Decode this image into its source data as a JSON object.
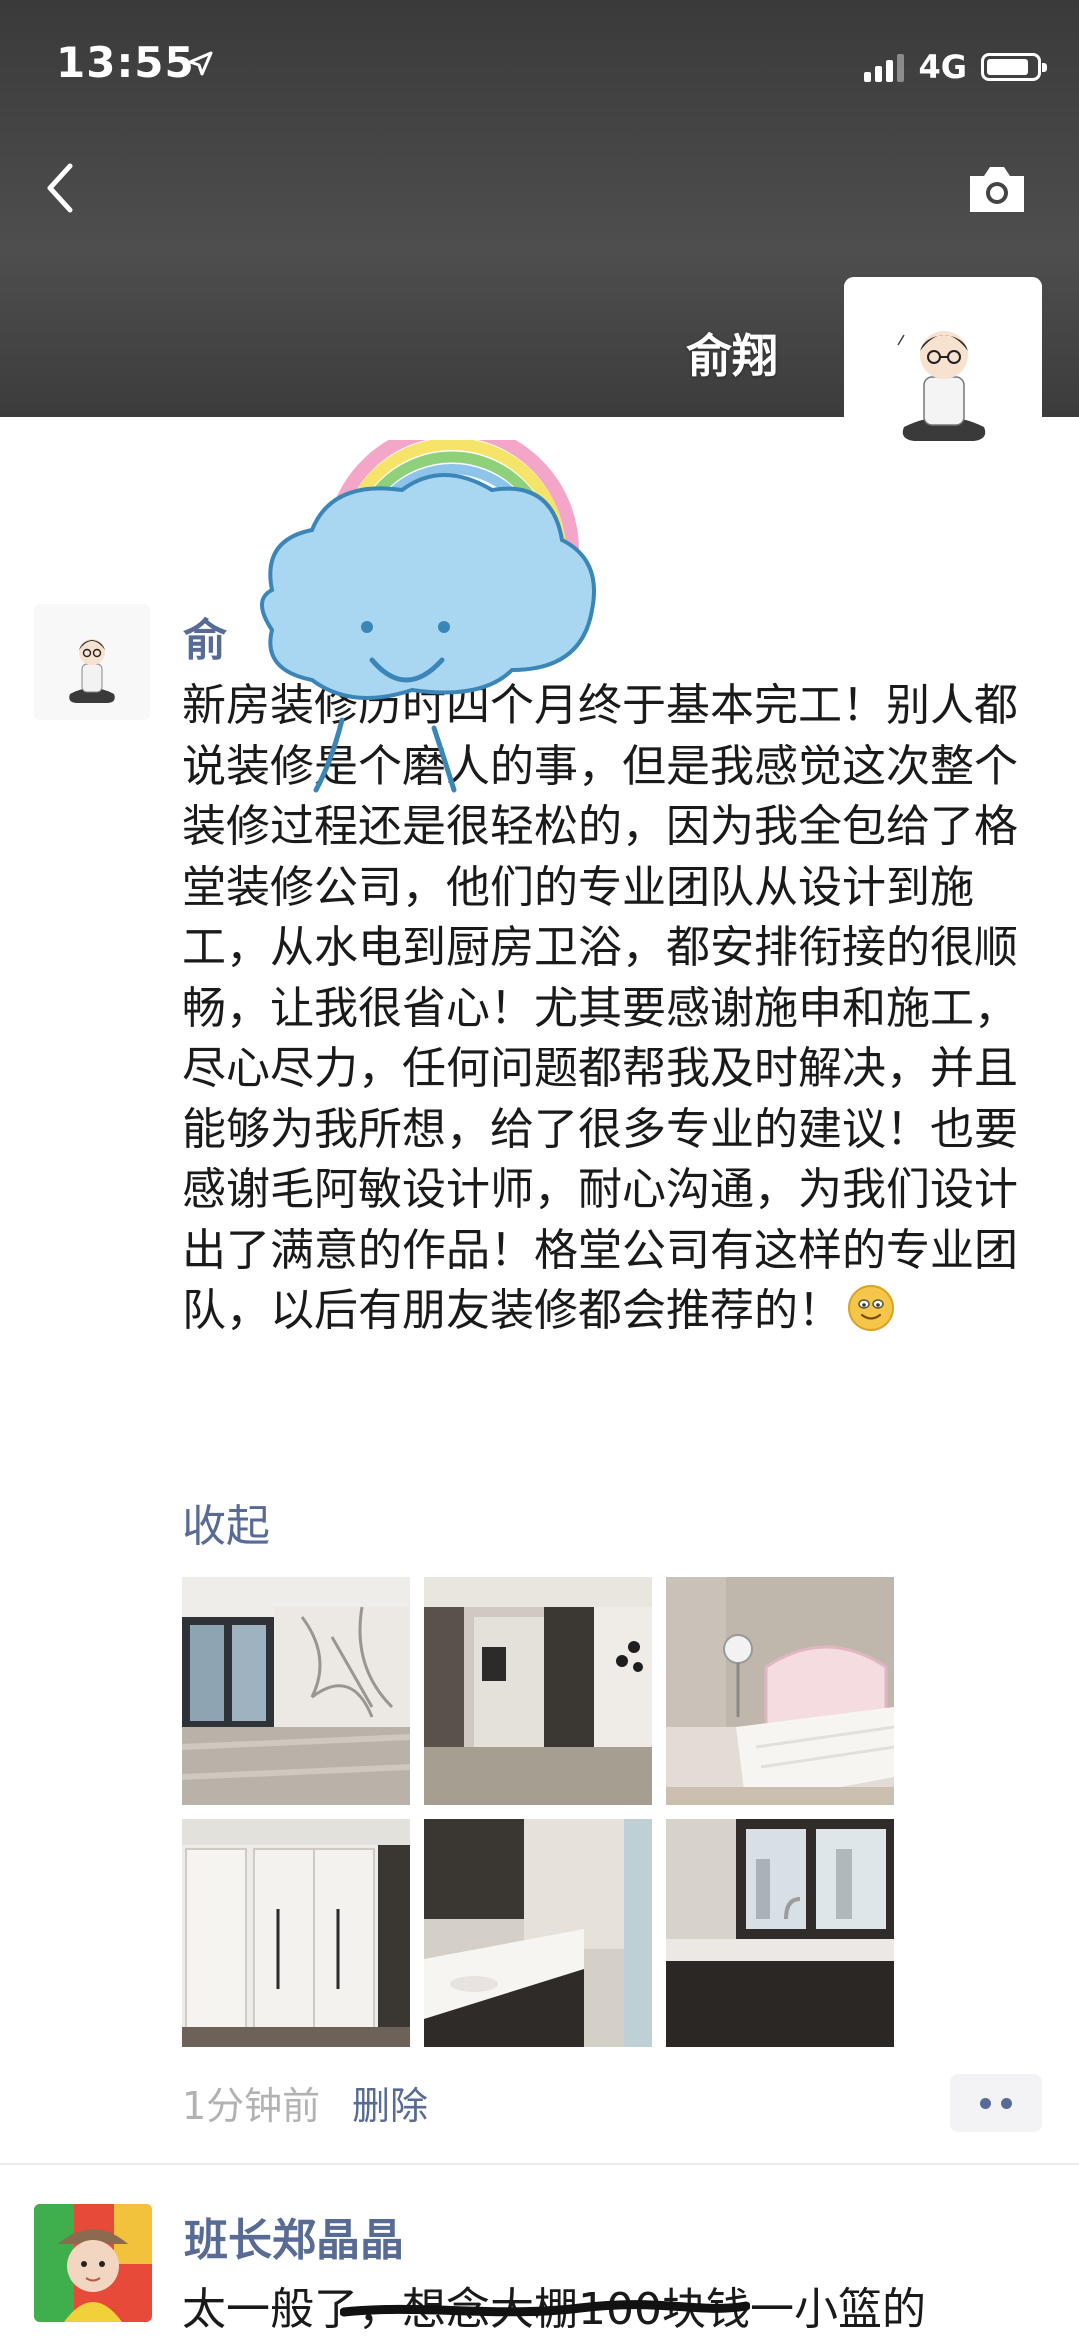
{
  "status_bar": {
    "time": "13:55",
    "network": "4G",
    "battery_level": 0.85,
    "icons": [
      "location-arrow-icon",
      "signal-icon",
      "battery-icon"
    ]
  },
  "header": {
    "back_icon": "chevron-left-icon",
    "camera_icon": "camera-icon",
    "profile_name": "俞翔"
  },
  "post": {
    "author": "俞",
    "text": "新房装修历时四个月终于基本完工！别人都说装修是个磨人的事，但是我感觉这次整个装修过程还是很轻松的，因为我全包给了格堂装修公司，他们的专业团队从设计到施工，从水电到厨房卫浴，都安排衔接的很顺畅，让我很省心！尤其要感谢施申和施工，尽心尽力，任何问题都帮我及时解决，并且能够为我所想，给了很多专业的建议！也要感谢毛阿敏设计师，耐心沟通，为我们设计出了满意的作品！格堂公司有这样的专业团队，以后有朋友装修都会推荐的！",
    "emoji": "smile-emoji",
    "collapse_label": "收起",
    "time_ago": "1分钟前",
    "delete_label": "删除",
    "more_icon": "more-dots-icon",
    "photos": [
      {
        "name": "photo-living-room"
      },
      {
        "name": "photo-kitchen"
      },
      {
        "name": "photo-bedroom"
      },
      {
        "name": "photo-wardrobe"
      },
      {
        "name": "photo-counter"
      },
      {
        "name": "photo-bathroom-sink"
      }
    ]
  },
  "comment": {
    "author": "班长郑晶晶",
    "text": "太一般了，想念大棚100块钱一小篮的"
  },
  "colors": {
    "link": "#576b95",
    "meta": "#b2b2b2",
    "text": "#1a1a1a",
    "banner": "#444444"
  }
}
